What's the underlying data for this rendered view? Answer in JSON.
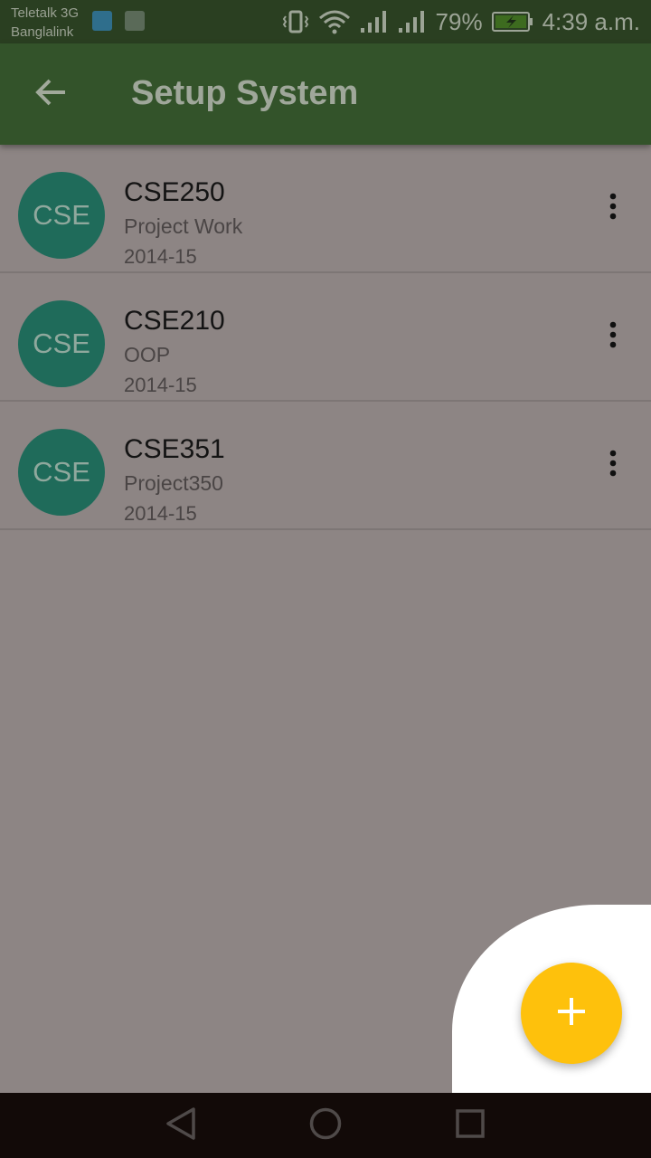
{
  "status_bar": {
    "carrier_1": "Teletalk 3G",
    "carrier_2": "Banglalink",
    "battery": "79%",
    "time": "4:39 a.m.",
    "icons": [
      "usb-icon",
      "image-icon",
      "vibrate-icon",
      "wifi-icon",
      "signal-icon",
      "signal-icon",
      "battery-charging-icon"
    ]
  },
  "app_bar": {
    "title": "Setup System",
    "back_icon": "arrow-back-icon"
  },
  "courses": [
    {
      "avatar": "CSE",
      "code": "CSE250",
      "name": "Project Work",
      "year": "2014-15"
    },
    {
      "avatar": "CSE",
      "code": "CSE210",
      "name": "OOP",
      "year": "2014-15"
    },
    {
      "avatar": "CSE",
      "code": "CSE351",
      "name": "Project350",
      "year": "2014-15"
    }
  ],
  "fab": {
    "icon": "plus-icon"
  },
  "nav_bar": {
    "icons": [
      "nav-back-icon",
      "nav-home-icon",
      "nav-recents-icon"
    ]
  },
  "colors": {
    "app_bar": "#33532a",
    "status_bar": "#2a3f21",
    "avatar": "#1f6b5a",
    "fab": "#fec10c",
    "scrim_background": "#8d8584"
  }
}
